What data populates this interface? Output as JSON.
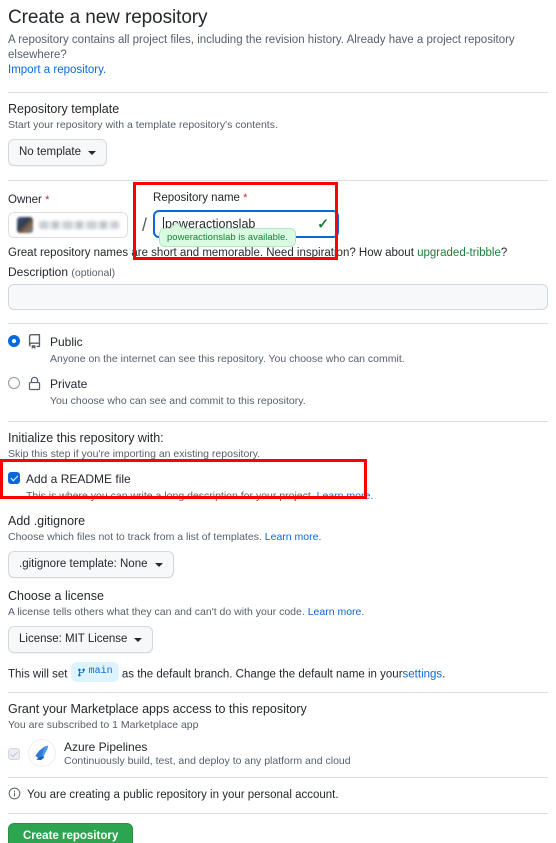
{
  "header": {
    "title": "Create a new repository",
    "subtitle": "A repository contains all project files, including the revision history. Already have a project repository elsewhere?",
    "import_link": "Import a repository."
  },
  "template_section": {
    "title": "Repository template",
    "subtitle": "Start your repository with a template repository's contents.",
    "select_label": "No template"
  },
  "owner": {
    "label": "Owner",
    "required_mark": "*",
    "separator": "/"
  },
  "repo_name": {
    "label": "Repository name",
    "required_mark": "*",
    "value": "poweractionslab",
    "check_icon": "✓",
    "availability_tooltip": "poweractionslab is available.",
    "hint_prefix": "Great repository names are short and memorable. Need inspiration? How about ",
    "hint_suggestion": "upgraded-tribble",
    "hint_suffix": "?"
  },
  "description": {
    "label": "Description",
    "optional": "(optional)",
    "value": "",
    "placeholder": ""
  },
  "visibility": {
    "options": [
      {
        "name": "Public",
        "desc": "Anyone on the internet can see this repository. You choose who can commit.",
        "selected": true,
        "icon": "repo-icon"
      },
      {
        "name": "Private",
        "desc": "You choose who can see and commit to this repository.",
        "selected": false,
        "icon": "lock-icon"
      }
    ]
  },
  "initialize": {
    "title": "Initialize this repository with:",
    "subtitle": "Skip this step if you're importing an existing repository.",
    "readme": {
      "label": "Add a README file",
      "desc": "This is where you can write a long description for your project.",
      "learn_more": "Learn more.",
      "checked": true
    }
  },
  "gitignore": {
    "title": "Add .gitignore",
    "subtitle": "Choose which files not to track from a list of templates.",
    "learn_more": "Learn more.",
    "select_label": ".gitignore template: None"
  },
  "license": {
    "title": "Choose a license",
    "subtitle": "A license tells others what they can and can't do with your code.",
    "learn_more": "Learn more.",
    "select_label": "License: MIT License"
  },
  "branch": {
    "prefix": "This will set",
    "badge": "main",
    "middle": "as the default branch. Change the default name in your",
    "settings_link": "settings",
    "suffix": "."
  },
  "marketplace": {
    "title": "Grant your Marketplace apps access to this repository",
    "subtitle": "You are subscribed to 1 Marketplace app",
    "apps": [
      {
        "name": "Azure Pipelines",
        "desc": "Continuously build, test, and deploy to any platform and cloud",
        "checked": true,
        "disabled": true
      }
    ]
  },
  "footer": {
    "notice": "You are creating a public repository in your personal account.",
    "create_button": "Create repository"
  },
  "colors": {
    "accent": "#0969da",
    "success": "#1a7f37",
    "button_green": "#2da44e",
    "danger": "#cf222e",
    "annotation_red": "#ff0000",
    "tooltip_bg": "#dafbe1"
  }
}
